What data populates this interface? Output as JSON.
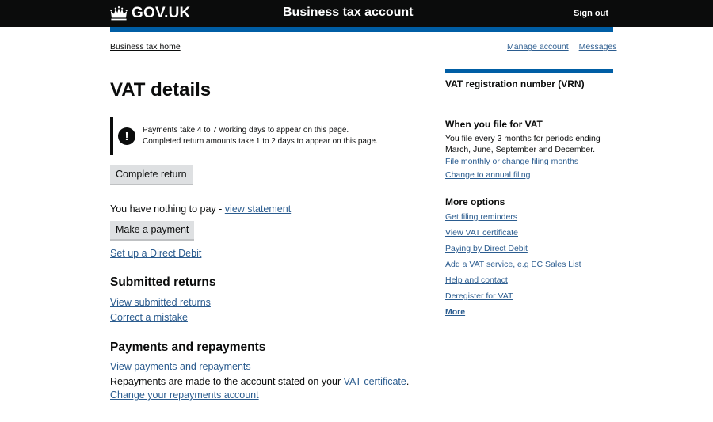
{
  "header": {
    "logo_text": "GOV.UK",
    "service_name": "Business tax account",
    "sign_out": "Sign out",
    "accent_color": "#005ea5"
  },
  "breadcrumb": {
    "home": "Business tax home"
  },
  "top_links": [
    {
      "label": "Manage account"
    },
    {
      "label": "Messages"
    }
  ],
  "main": {
    "title": "VAT details",
    "notice": {
      "icon": "exclamation-icon",
      "line1": "Payments take 4 to 7 working days to appear on this page.",
      "line2": "Completed return amounts take 1 to 2 days to appear on this page."
    },
    "complete_return_button": "Complete return",
    "nothing_to_pay": "You have nothing to pay - ",
    "view_statement": "view statement",
    "make_payment_button": "Make a payment",
    "direct_debit_link": "Set up a Direct Debit",
    "submitted_returns": {
      "heading": "Submitted returns",
      "links": [
        "View submitted returns",
        "Correct a mistake"
      ]
    },
    "payments": {
      "heading": "Payments and repayments",
      "view_link": "View payments and repayments",
      "repayments_text": "Repayments are made to the account stated on your ",
      "vat_certificate_link": "VAT certificate",
      "repayments_text_end": ".",
      "change_account_link": "Change your repayments account"
    }
  },
  "sidebar": {
    "vrn_heading": "VAT registration number (VRN)",
    "when_heading": "When you file for VAT",
    "when_text": "You file every 3 months for periods ending March, June, September and December.",
    "when_links": [
      "File monthly or change filing months",
      "Change to annual filing"
    ],
    "more_heading": "More options",
    "more_links": [
      "Get filing reminders",
      "View VAT certificate",
      "Paying by Direct Debit",
      "Add a VAT service, e.g EC Sales List",
      "Help and contact",
      "Deregister for VAT"
    ],
    "more_link": "More"
  }
}
